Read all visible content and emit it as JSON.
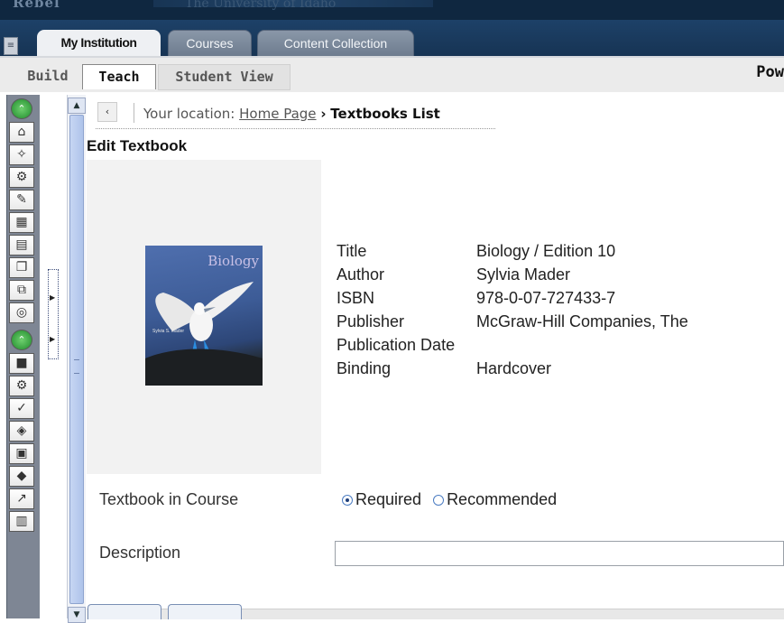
{
  "banner": {
    "logo_text": "Rebel",
    "tagline": "The University of Idaho"
  },
  "tabs": [
    {
      "label": "My Institution",
      "active": true
    },
    {
      "label": "Courses",
      "active": false
    },
    {
      "label": "Content Collection",
      "active": false
    }
  ],
  "modes": {
    "build": "Build",
    "teach": "Teach",
    "student_view": "Student View",
    "right_text": "Pow"
  },
  "tool_rail": {
    "icons": [
      "collapse-icon",
      "home-icon",
      "announcements-icon",
      "tools-icon",
      "edit-icon",
      "calendar-icon",
      "content-icon",
      "documents-icon",
      "copy-icon",
      "web-icon",
      "collapse-icon",
      "gradebook-icon",
      "assessment-icon",
      "grading-icon",
      "reports-icon",
      "groups-icon",
      "evaluation-icon",
      "performance-icon",
      "more-icon"
    ]
  },
  "breadcrumb": {
    "prefix": "Your location:",
    "link": "Home Page",
    "separator": "›",
    "current": "Textbooks List"
  },
  "page_title": "Edit Textbook",
  "book": {
    "cover_title": "Biology",
    "cover_author": "Sylvia S. Mader",
    "details": [
      {
        "label": "Title",
        "value": "Biology / Edition 10"
      },
      {
        "label": "Author",
        "value": "Sylvia Mader"
      },
      {
        "label": "ISBN",
        "value": "978-0-07-727433-7"
      },
      {
        "label": "Publisher",
        "value": "McGraw-Hill Companies, The"
      },
      {
        "label": "Publication Date",
        "value": ""
      },
      {
        "label": "Binding",
        "value": "Hardcover"
      }
    ]
  },
  "textbook_in_course": {
    "label": "Textbook in Course",
    "options": [
      "Required",
      "Recommended"
    ],
    "selected": "Required"
  },
  "description": {
    "label": "Description",
    "value": ""
  }
}
